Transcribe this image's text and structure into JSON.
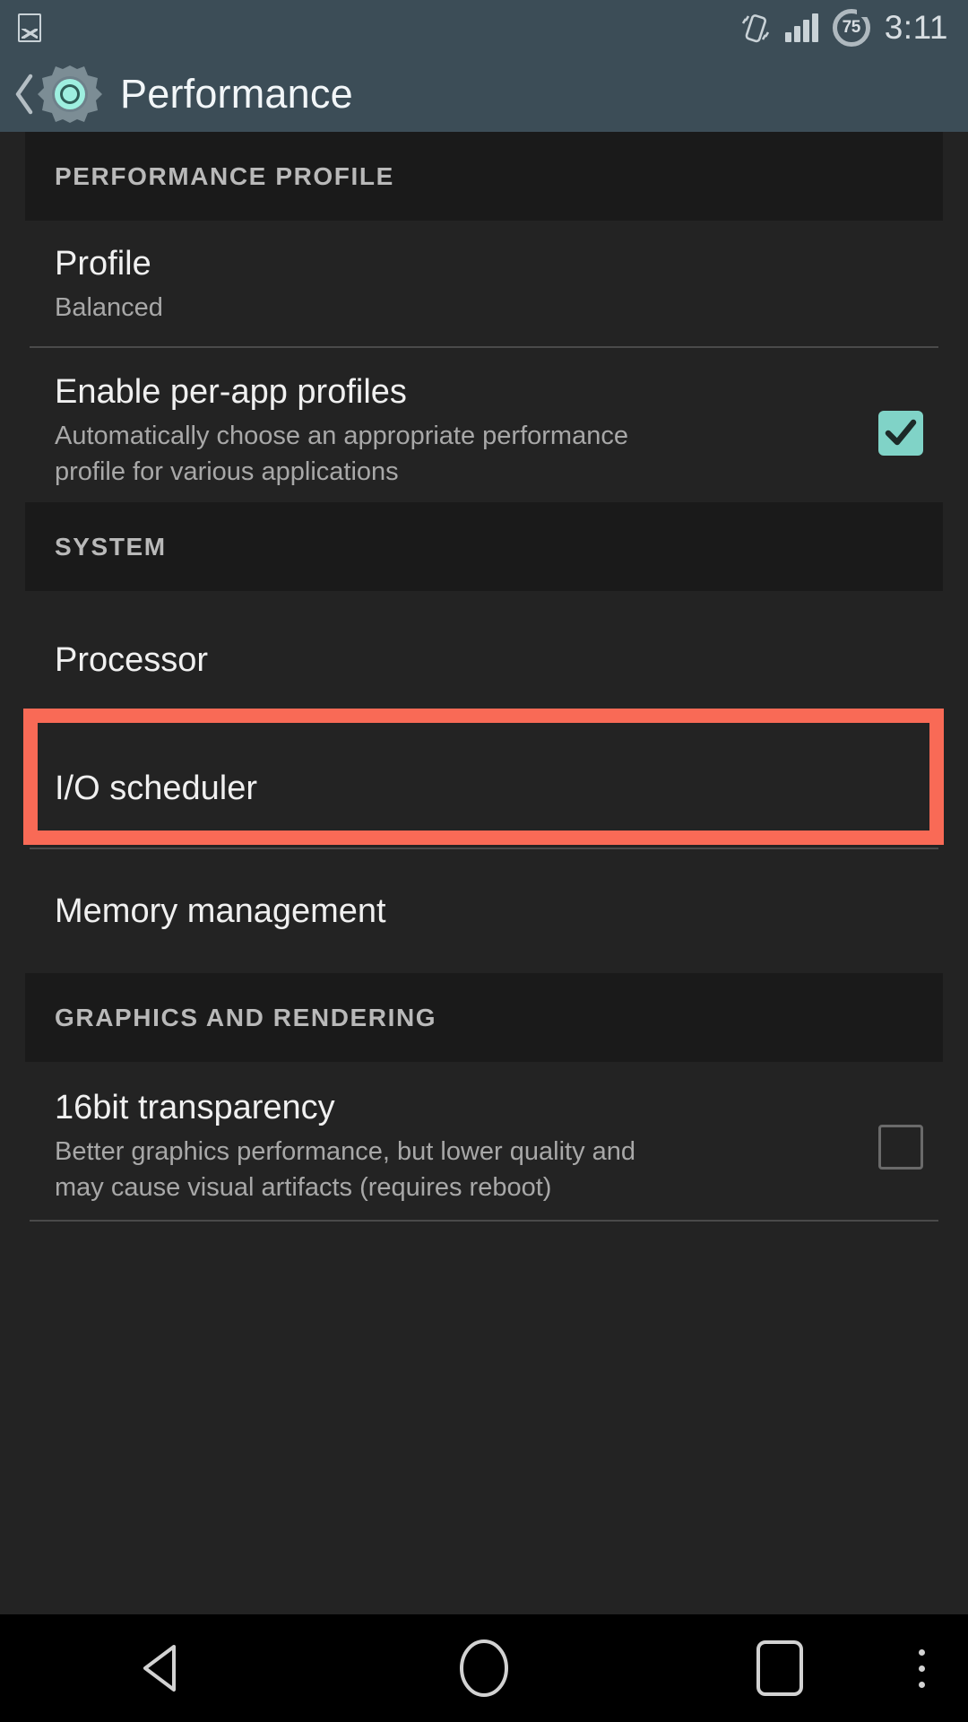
{
  "statusbar": {
    "time": "3:11",
    "battery_level": "75",
    "icons": [
      "gallery-icon",
      "vibrate-icon",
      "signal-icon",
      "battery-icon"
    ]
  },
  "appbar": {
    "title": "Performance",
    "back_label": "Back",
    "app_icon": "gear-icon"
  },
  "colors": {
    "appbar_bg": "#3C4D57",
    "content_bg": "#232323",
    "section_bg": "#1A1A1A",
    "accent_mint": "#80D3C7",
    "highlight_red": "#F96A56"
  },
  "sections": [
    {
      "header": "PERFORMANCE PROFILE",
      "items": [
        {
          "title": "Profile",
          "subtitle": "Balanced",
          "control": "none",
          "divider_after": true
        },
        {
          "title": "Enable per-app profiles",
          "subtitle": "Automatically choose an appropriate performance profile for various applications",
          "control": "checkbox",
          "checked": true,
          "divider_after": false
        }
      ]
    },
    {
      "header": "SYSTEM",
      "items": [
        {
          "title": "Processor",
          "subtitle": "",
          "control": "none",
          "highlighted": true,
          "divider_after": false
        },
        {
          "title": "I/O scheduler",
          "subtitle": "",
          "control": "none",
          "divider_after": true
        },
        {
          "title": "Memory management",
          "subtitle": "",
          "control": "none",
          "divider_after": false
        }
      ]
    },
    {
      "header": "GRAPHICS AND RENDERING",
      "items": [
        {
          "title": "16bit transparency",
          "subtitle": "Better graphics performance, but lower quality and may cause visual artifacts (requires reboot)",
          "control": "checkbox",
          "checked": false,
          "divider_after": true
        }
      ]
    }
  ],
  "navbar": {
    "back": "back-triangle-icon",
    "home": "home-circle-icon",
    "recents": "recents-square-icon",
    "more": "overflow-menu-icon"
  }
}
